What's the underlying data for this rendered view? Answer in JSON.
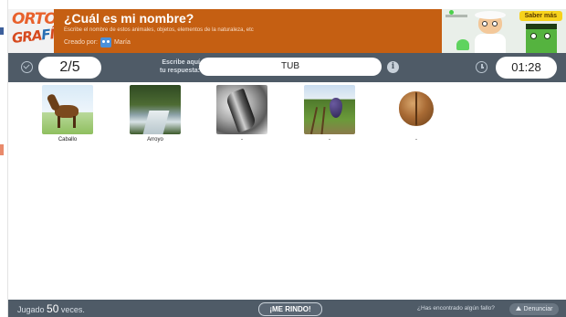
{
  "header": {
    "logo": "ORTOGRAFÍA",
    "title": "¿Cuál es mi nombre?",
    "subtitle": "Escribe el nombre de estos animales, objetos, elementos de la naturaleza, etc",
    "created_by_label": "Creado por:",
    "author": "María",
    "saber_mas": "Saber más"
  },
  "toolbar": {
    "counter": "2/5",
    "prompt_line1": "Escribe aquí",
    "prompt_line2": "tu respuesta:",
    "answer_value": "TUB",
    "info_icon": "i",
    "timer": "01:28"
  },
  "items": [
    {
      "caption": "Caballo",
      "icon": "horse-image"
    },
    {
      "caption": "Arroyo",
      "icon": "stream-image"
    },
    {
      "caption": "-",
      "icon": "metal-tube-image"
    },
    {
      "caption": "-",
      "icon": "vineyard-image"
    },
    {
      "caption": "-",
      "icon": "walnut-image"
    }
  ],
  "footer": {
    "played_prefix": "Jugado",
    "played_count": "50",
    "played_suffix": "veces.",
    "give_up": "¡ME RINDO!",
    "found_error": "¿Has encontrado algún fallo?",
    "report": "Denunciar"
  },
  "colors": {
    "header_bg": "#c55f12",
    "bar_bg": "#4f5b67",
    "saber_mas_bg": "#f7d21c"
  }
}
